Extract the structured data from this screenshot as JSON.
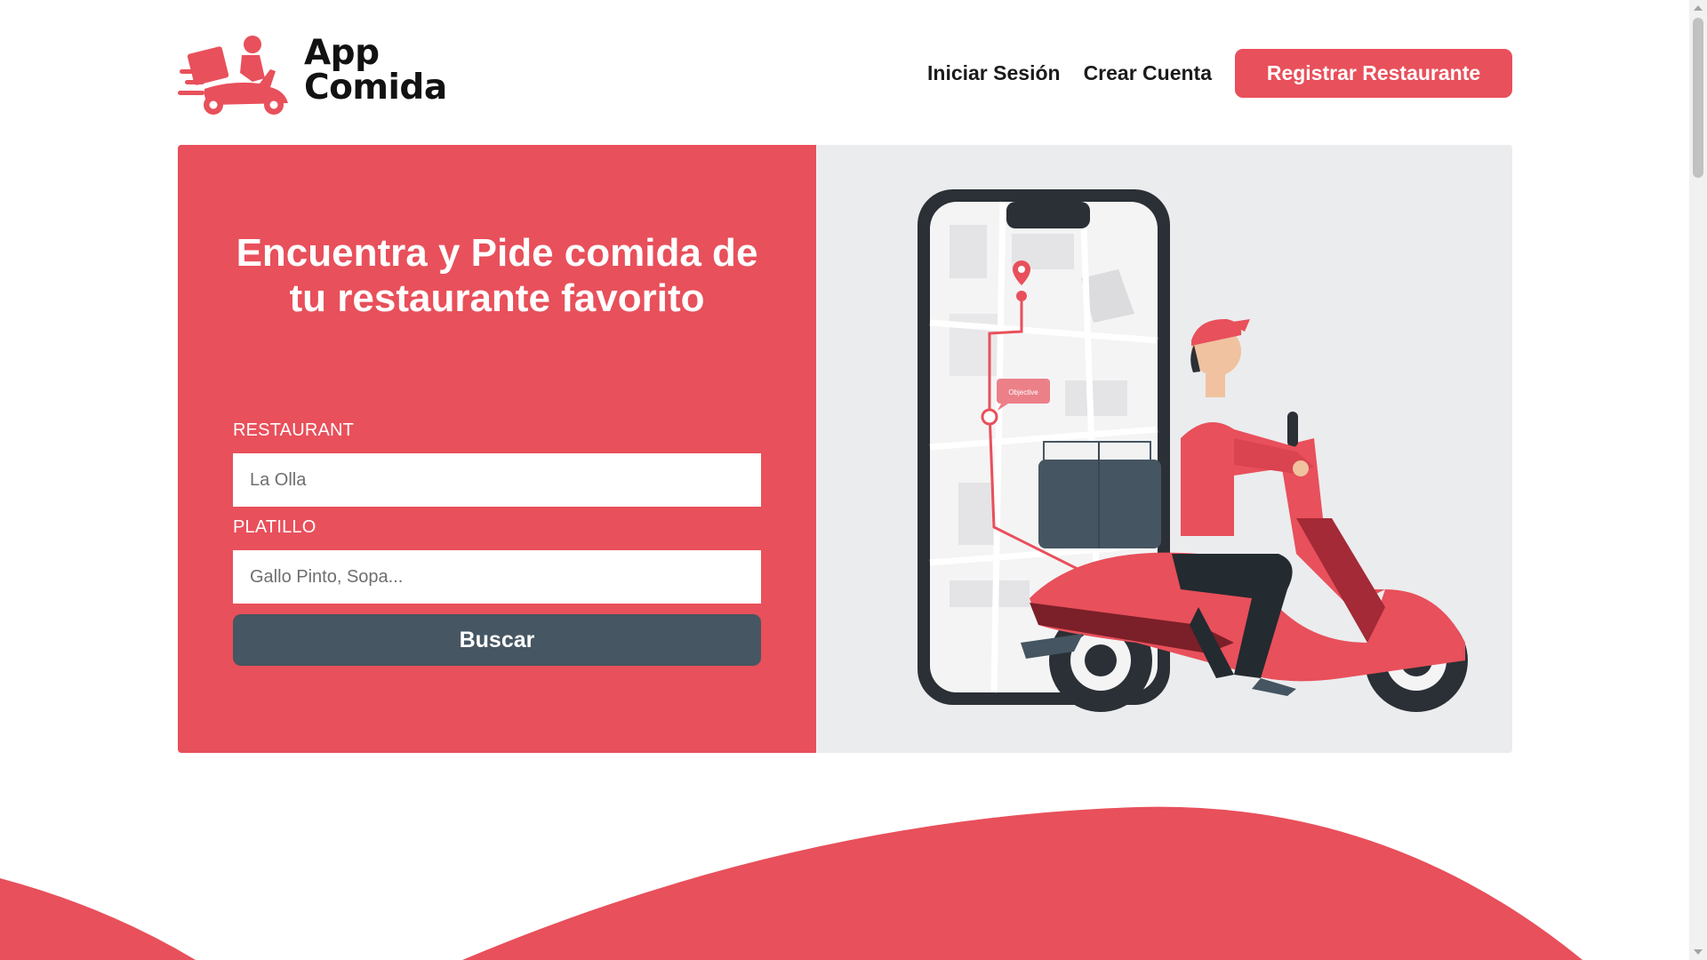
{
  "header": {
    "logo": {
      "line1": "App",
      "line2": "Comida"
    },
    "nav": {
      "login": "Iniciar Sesión",
      "signup": "Crear Cuenta",
      "register_restaurant": "Registrar Restaurante"
    }
  },
  "hero": {
    "title": "Encuentra y Pide comida de tu restaurante favorito",
    "form": {
      "restaurant_label": "RESTAURANT",
      "restaurant_placeholder": "La Olla",
      "dish_label": "PLATILLO",
      "dish_placeholder": "Gallo Pinto, Sopa...",
      "search_button": "Buscar"
    },
    "illustration": {
      "map_tag": "Objective"
    }
  },
  "colors": {
    "brand_red": "#e8505b",
    "dark_slate": "#465662",
    "hero_bg": "#ebecee"
  },
  "icons": {
    "logo_mark": "delivery-scooter-icon",
    "map_pin": "map-pin-icon"
  }
}
